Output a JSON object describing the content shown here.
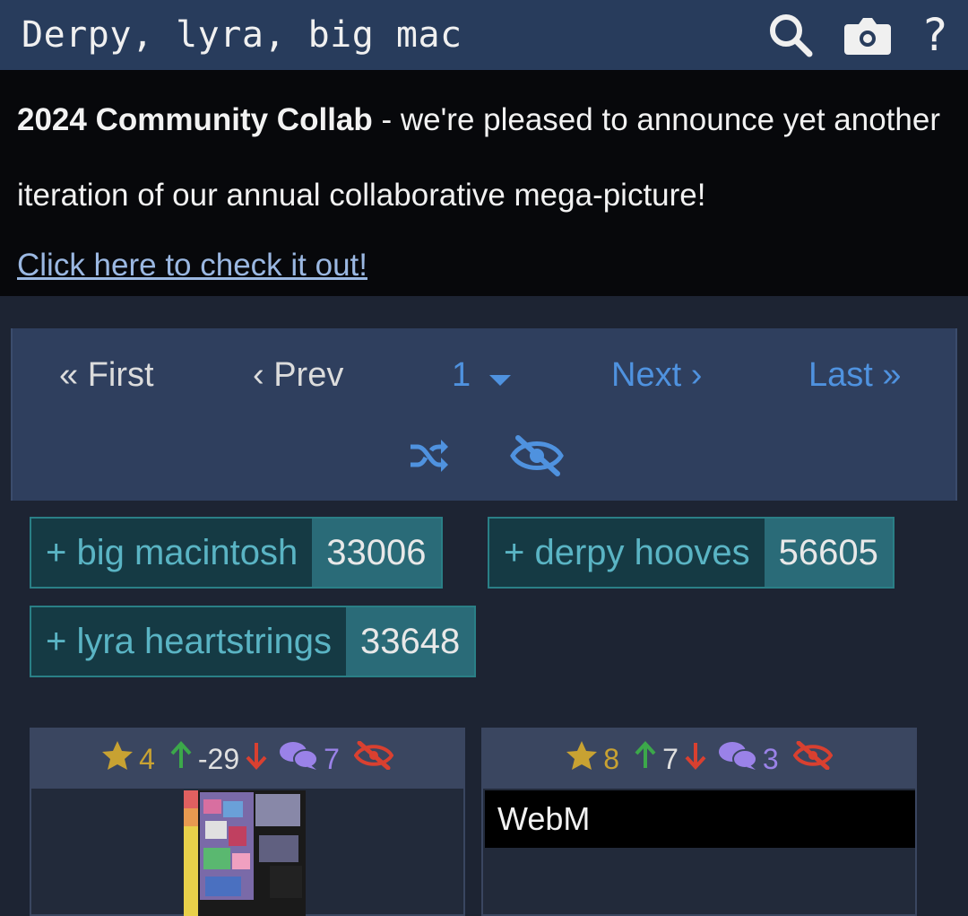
{
  "header": {
    "search_query": "Derpy, lyra, big mac",
    "icons": [
      "search-icon",
      "camera-icon",
      "help-icon"
    ],
    "help_glyph": "?"
  },
  "notice": {
    "title": "2024 Community Collab",
    "text": " - we're pleased to announce yet another iteration of our annual collaborative mega-picture!",
    "link": "Click here to check it out!"
  },
  "pagination": {
    "first": "« First",
    "prev": "‹ Prev",
    "current": "1",
    "next": "Next ›",
    "last": "Last »",
    "tools": [
      "shuffle-icon",
      "hidden-toggle-icon"
    ]
  },
  "tags": [
    {
      "name": "+ big macintosh",
      "count": "33006"
    },
    {
      "name": "+ derpy hooves",
      "count": "56605"
    },
    {
      "name": "+ lyra heartstrings",
      "count": "33648"
    }
  ],
  "images": [
    {
      "faves": "4",
      "score": "-29",
      "comments": "7",
      "thumb": "image"
    },
    {
      "faves": "8",
      "score": "7",
      "comments": "3",
      "label": "WebM"
    }
  ],
  "colors": {
    "header_bg": "#283c5c",
    "link_blue": "#4f92df",
    "tag_name": "#5ab4c4",
    "fave_gold": "#c8a232",
    "upvote_green": "#3ca84a",
    "downvote_red": "#d94030",
    "comment_purple": "#9a82e8"
  }
}
